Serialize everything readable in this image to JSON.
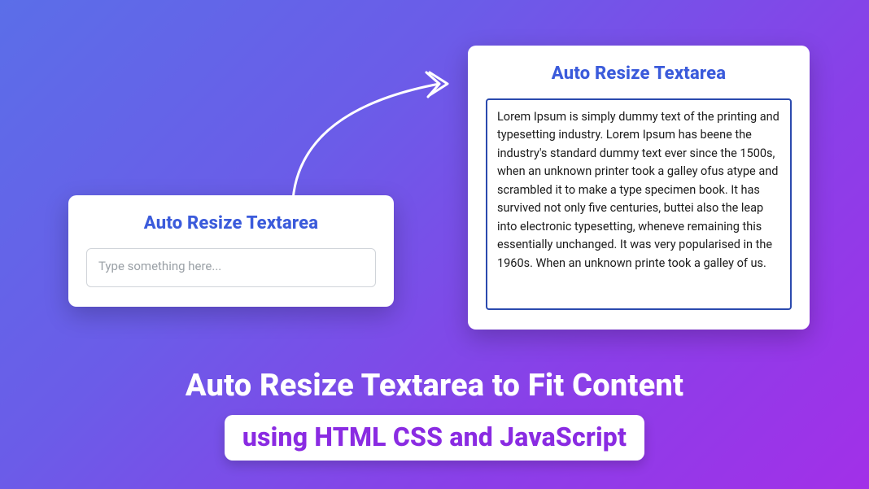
{
  "card_small": {
    "title": "Auto Resize Textarea",
    "placeholder": "Type something here..."
  },
  "card_large": {
    "title": "Auto Resize Textarea",
    "content": "Lorem Ipsum is simply dummy text of the printing and typesetting industry. Lorem Ipsum has beene the industry's standard dummy text ever since the 1500s, when an unknown printer took a galley ofus atype and scrambled it to make a type specimen book. It has survived not only five centuries, buttei also the leap into electronic typesetting, wheneve remaining this essentially unchanged. It was very popularised in the 1960s. When an unknown printe took a galley of us."
  },
  "headline": {
    "line1": "Auto Resize Textarea to Fit Content",
    "line2": "using HTML CSS and JavaScript"
  }
}
